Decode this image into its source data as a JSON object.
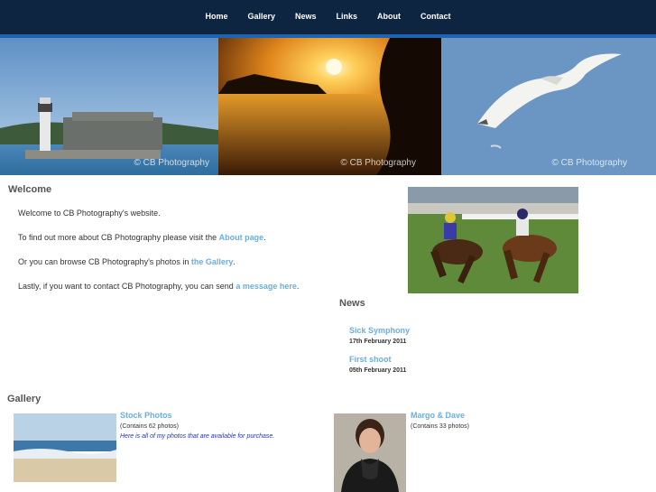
{
  "nav": {
    "items": [
      "Home",
      "Gallery",
      "News",
      "Links",
      "About",
      "Contact"
    ]
  },
  "banner": {
    "watermarks": [
      "© CB Photography",
      "© CB Photography",
      "© CB Photography"
    ]
  },
  "welcome": {
    "title": "Welcome",
    "line1": "Welcome to CB Photography's website.",
    "line2_pre": "To find out more about CB Photography please visit the ",
    "line2_link": "About page",
    "line2_post": ".",
    "line3_pre": "Or you can browse CB Photography's photos in ",
    "line3_link": "the Gallery",
    "line3_post": ".",
    "line4_pre": "Lastly, if you want to contact CB Photography, you can send ",
    "line4_link": "a message here",
    "line4_post": "."
  },
  "news": {
    "title": "News",
    "items": [
      {
        "title": "Sick Symphony",
        "date": "17th February 2011"
      },
      {
        "title": "First shoot",
        "date": "05th February 2011"
      }
    ]
  },
  "gallery": {
    "title": "Gallery",
    "albums": [
      {
        "name": "Stock Photos",
        "count": "(Contains 62 photos)",
        "description": "Here is all of my photos that are available for purchase."
      },
      {
        "name": "Margo & Dave",
        "count": "(Contains 33 photos)",
        "description": ""
      }
    ]
  },
  "colors": {
    "nav_bg": "#0e2541",
    "nav_accent": "#1f63b5",
    "link": "#6aaee0",
    "description": "#2233cc"
  }
}
